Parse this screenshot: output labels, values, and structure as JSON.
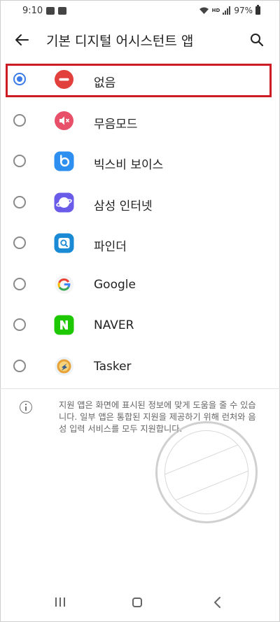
{
  "status": {
    "time": "9:10",
    "hd": "HD",
    "battery": "97%"
  },
  "header": {
    "title": "기본 디지털 어시스턴트 앱"
  },
  "options": [
    {
      "label": "없음",
      "selected": true,
      "icon": "no-entry-icon"
    },
    {
      "label": "무음모드",
      "selected": false,
      "icon": "mute-speaker-icon"
    },
    {
      "label": "빅스비 보이스",
      "selected": false,
      "icon": "bixby-icon"
    },
    {
      "label": "삼성 인터넷",
      "selected": false,
      "icon": "samsung-internet-icon"
    },
    {
      "label": "파인더",
      "selected": false,
      "icon": "finder-icon"
    },
    {
      "label": "Google",
      "selected": false,
      "icon": "google-icon"
    },
    {
      "label": "NAVER",
      "selected": false,
      "icon": "naver-icon"
    },
    {
      "label": "Tasker",
      "selected": false,
      "icon": "tasker-icon"
    }
  ],
  "info": {
    "text": "지원 앱은 화면에 표시된 정보에 맞게 도움을 줄 수 있습니다. 일부 앱은 통합된 지원을 제공하기 위해 런처와 음성 입력 서비스를 모두 지원합니다."
  },
  "colors": {
    "accent": "#3c7be8",
    "highlight": "#cc1c26"
  }
}
